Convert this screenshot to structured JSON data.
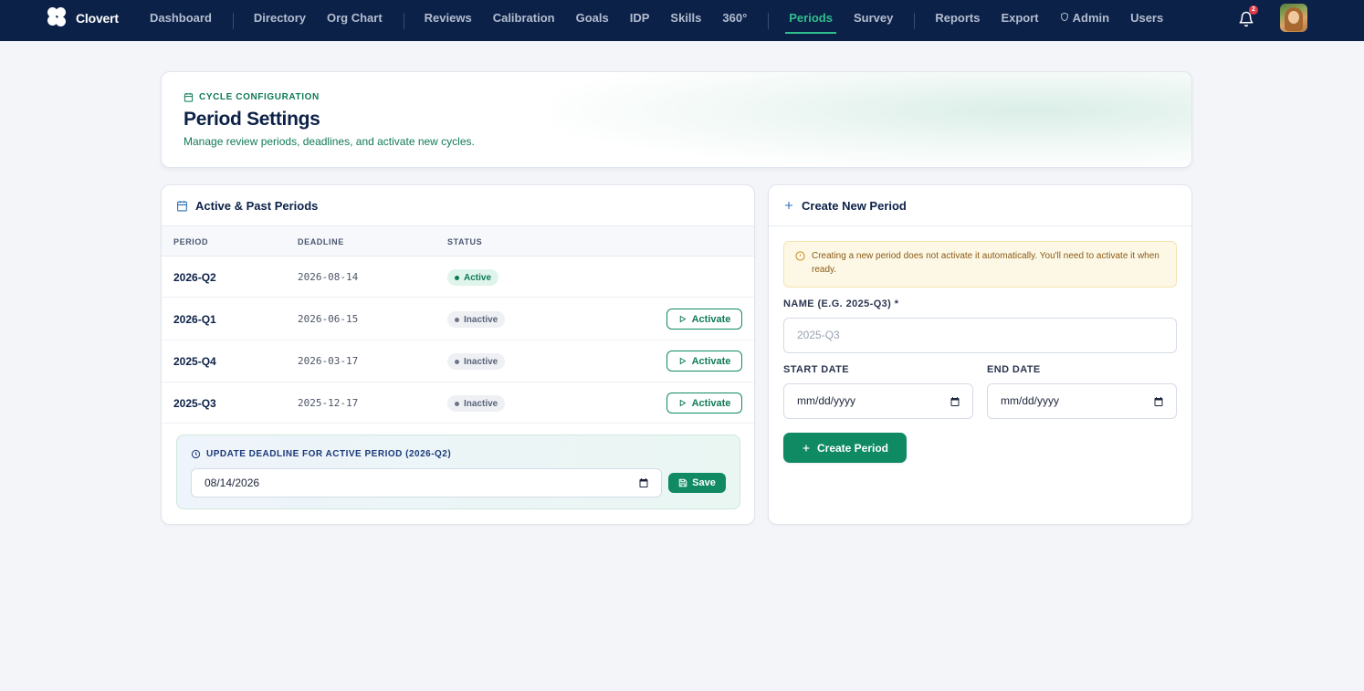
{
  "brand": {
    "name": "Clovert"
  },
  "nav": {
    "items": [
      {
        "label": "Dashboard",
        "active": false,
        "sep_after": true
      },
      {
        "label": "Directory",
        "active": false,
        "sep_after": false
      },
      {
        "label": "Org Chart",
        "active": false,
        "sep_after": true
      },
      {
        "label": "Reviews",
        "active": false,
        "sep_after": false
      },
      {
        "label": "Calibration",
        "active": false,
        "sep_after": false
      },
      {
        "label": "Goals",
        "active": false,
        "sep_after": false
      },
      {
        "label": "IDP",
        "active": false,
        "sep_after": false
      },
      {
        "label": "Skills",
        "active": false,
        "sep_after": false
      },
      {
        "label": "360°",
        "active": false,
        "sep_after": true
      },
      {
        "label": "Periods",
        "active": true,
        "sep_after": false
      },
      {
        "label": "Survey",
        "active": false,
        "sep_after": true
      },
      {
        "label": "Reports",
        "active": false,
        "sep_after": false
      },
      {
        "label": "Export",
        "active": false,
        "sep_after": false
      },
      {
        "label": "Admin",
        "active": false,
        "sep_after": false,
        "icon": "shield-icon"
      },
      {
        "label": "Users",
        "active": false,
        "sep_after": false
      }
    ],
    "notifications_count": "2"
  },
  "header": {
    "eyebrow": "CYCLE CONFIGURATION",
    "title": "Period Settings",
    "subtitle": "Manage review periods, deadlines, and activate new cycles."
  },
  "periods": {
    "title": "Active & Past Periods",
    "columns": {
      "period": "PERIOD",
      "deadline": "DEADLINE",
      "status": "STATUS"
    },
    "rows": [
      {
        "period": "2026-Q2",
        "deadline": "2026-08-14",
        "status": "Active",
        "active": true
      },
      {
        "period": "2026-Q1",
        "deadline": "2026-06-15",
        "status": "Inactive",
        "active": false
      },
      {
        "period": "2025-Q4",
        "deadline": "2026-03-17",
        "status": "Inactive",
        "active": false
      },
      {
        "period": "2025-Q3",
        "deadline": "2025-12-17",
        "status": "Inactive",
        "active": false
      }
    ],
    "activate_label": "Activate",
    "update_deadline": {
      "label": "UPDATE DEADLINE FOR ACTIVE PERIOD (2026-Q2)",
      "value": "08/14/2026",
      "save_label": "Save"
    }
  },
  "create": {
    "title": "Create New Period",
    "notice": "Creating a new period does not activate it automatically. You'll need to activate it when ready.",
    "name_label": "NAME (E.G. 2025-Q3) *",
    "name_placeholder": "2025-Q3",
    "start_label": "START DATE",
    "start_value": "mm/dd/yyyy",
    "end_label": "END DATE",
    "end_value": "mm/dd/yyyy",
    "button_label": "Create Period"
  },
  "colors": {
    "nav_bg": "#0c2148",
    "accent": "#0f8a62",
    "active_nav": "#2fbf8c",
    "warning_bg": "#fdf8e6"
  }
}
